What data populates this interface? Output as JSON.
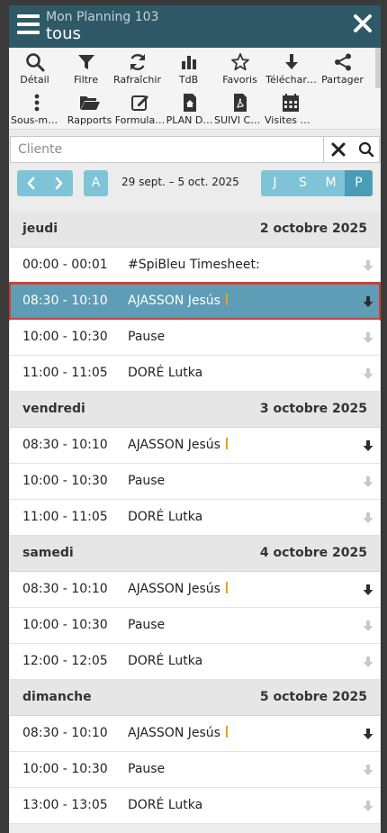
{
  "header": {
    "subtitle": "Mon Planning 103",
    "title": "tous"
  },
  "toolbar1": [
    {
      "label": "Détail",
      "icon": "search-icon"
    },
    {
      "label": "Filtre",
      "icon": "filter-icon"
    },
    {
      "label": "Rafraîchir",
      "icon": "refresh-icon"
    },
    {
      "label": "TdB",
      "icon": "bar-chart-icon"
    },
    {
      "label": "Favoris",
      "icon": "star-icon"
    },
    {
      "label": "Téléchar…",
      "icon": "download-icon"
    },
    {
      "label": "Partager",
      "icon": "share-icon"
    }
  ],
  "toolbar2": [
    {
      "label": "Sous-me…",
      "icon": "more-vertical-icon"
    },
    {
      "label": "Rapports",
      "icon": "folder-open-icon"
    },
    {
      "label": "Formula…",
      "icon": "edit-form-icon"
    },
    {
      "label": "PLAN D…",
      "icon": "house-document-icon"
    },
    {
      "label": "SUIVI CL…",
      "icon": "pdf-document-icon"
    },
    {
      "label": "Visites p…",
      "icon": "calendar-icon"
    }
  ],
  "search": {
    "placeholder": "Cliente"
  },
  "nav": {
    "today_label": "A",
    "date_range": "29 sept. – 5 oct. 2025",
    "views": [
      "J",
      "S",
      "M",
      "P"
    ],
    "active_view": "P"
  },
  "days": [
    {
      "day": "jeudi",
      "date": "2 octobre 2025",
      "rows": [
        {
          "time": "00:00 - 00:01",
          "name": "#SpiBleu Timesheet:",
          "marker": false,
          "selected": false,
          "arrow_dark": false
        },
        {
          "time": "08:30 - 10:10",
          "name": "AJASSON Jesús",
          "marker": true,
          "selected": true,
          "arrow_dark": true
        },
        {
          "time": "10:00 - 10:30",
          "name": "Pause",
          "marker": false,
          "selected": false,
          "arrow_dark": false
        },
        {
          "time": "11:00 - 11:05",
          "name": "DORÉ Lutka",
          "marker": false,
          "selected": false,
          "arrow_dark": false
        }
      ]
    },
    {
      "day": "vendredi",
      "date": "3 octobre 2025",
      "rows": [
        {
          "time": "08:30 - 10:10",
          "name": "AJASSON Jesús",
          "marker": true,
          "selected": false,
          "arrow_dark": true
        },
        {
          "time": "10:00 - 10:30",
          "name": "Pause",
          "marker": false,
          "selected": false,
          "arrow_dark": false
        },
        {
          "time": "11:00 - 11:05",
          "name": "DORÉ Lutka",
          "marker": false,
          "selected": false,
          "arrow_dark": false
        }
      ]
    },
    {
      "day": "samedi",
      "date": "4 octobre 2025",
      "rows": [
        {
          "time": "08:30 - 10:10",
          "name": "AJASSON Jesús",
          "marker": true,
          "selected": false,
          "arrow_dark": true
        },
        {
          "time": "10:00 - 10:30",
          "name": "Pause",
          "marker": false,
          "selected": false,
          "arrow_dark": false
        },
        {
          "time": "12:00 - 12:05",
          "name": "DORÉ Lutka",
          "marker": false,
          "selected": false,
          "arrow_dark": false
        }
      ]
    },
    {
      "day": "dimanche",
      "date": "5 octobre 2025",
      "rows": [
        {
          "time": "08:30 - 10:10",
          "name": "AJASSON Jesús",
          "marker": true,
          "selected": false,
          "arrow_dark": true
        },
        {
          "time": "10:00 - 10:30",
          "name": "Pause",
          "marker": false,
          "selected": false,
          "arrow_dark": false
        },
        {
          "time": "13:00 - 13:05",
          "name": "DORÉ Lutka",
          "marker": false,
          "selected": false,
          "arrow_dark": false
        }
      ]
    }
  ],
  "colors": {
    "header_bg": "#2f5966",
    "accent": "#7ec3d6",
    "active_segment": "#4a9cb7",
    "selected_row": "#5e9db5",
    "selection_outline": "#d83b30",
    "marker": "#f0a020"
  }
}
